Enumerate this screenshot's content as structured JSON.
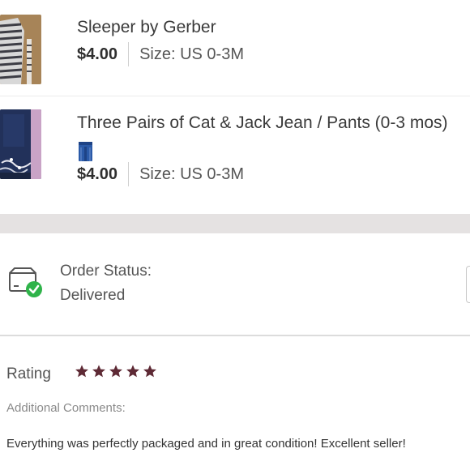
{
  "items": [
    {
      "title": "Sleeper by Gerber",
      "price": "$4.00",
      "size": "Size: US 0-3M",
      "thumbnail_icon": "striped-sleeper-photo"
    },
    {
      "title": "Three Pairs of Cat & Jack Jean / Pants (0-3 mos)",
      "price": "$4.00",
      "size": "Size: US 0-3M",
      "thumbnail_icon": "denim-jeans-photo",
      "category_icon": "jeans-icon"
    }
  ],
  "order_status": {
    "label": "Order Status:",
    "value": "Delivered",
    "icon": "package-delivered-icon",
    "accent_color": "#2fb34a"
  },
  "rating": {
    "label": "Rating",
    "stars": 5,
    "max_stars": 5,
    "star_color": "#5e2a35"
  },
  "comments": {
    "label": "Additional Comments:",
    "text": "Everything was perfectly packaged and in great condition! Excellent seller!"
  }
}
